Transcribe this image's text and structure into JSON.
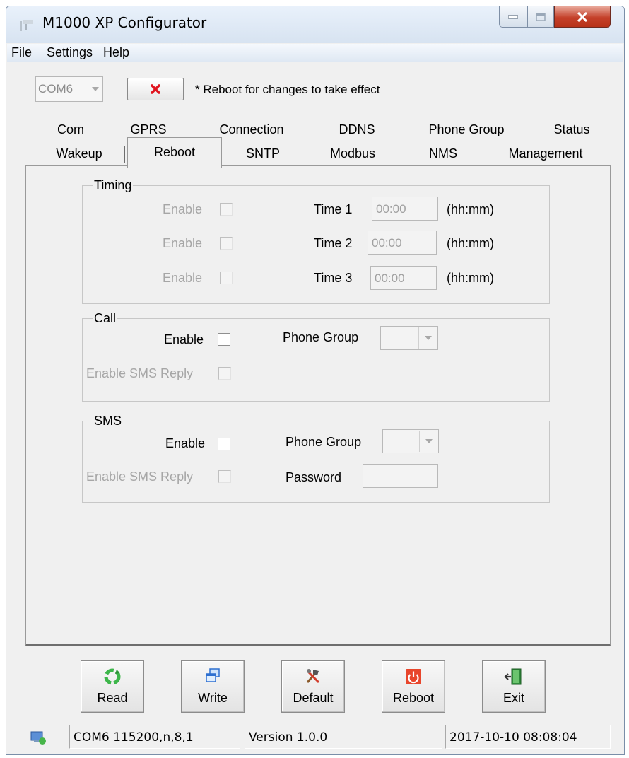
{
  "window": {
    "title": "M1000 XP Configurator"
  },
  "menu": {
    "file": "File",
    "settings": "Settings",
    "help": "Help"
  },
  "toolbar": {
    "com_port": "COM6",
    "reboot_note": "* Reboot for changes to take effect"
  },
  "tabs": {
    "row1": [
      "Com",
      "GPRS",
      "Connection",
      "DDNS",
      "Phone Group",
      "Status"
    ],
    "row2": [
      "Wakeup",
      "Reboot",
      "SNTP",
      "Modbus",
      "NMS",
      "Management"
    ],
    "selected": "Reboot"
  },
  "timing": {
    "legend": "Timing",
    "rows": [
      {
        "enable": "Enable",
        "time_label": "Time 1",
        "value": "00:00",
        "unit": "(hh:mm)"
      },
      {
        "enable": "Enable",
        "time_label": "Time 2",
        "value": "00:00",
        "unit": "(hh:mm)"
      },
      {
        "enable": "Enable",
        "time_label": "Time 3",
        "value": "00:00",
        "unit": "(hh:mm)"
      }
    ]
  },
  "call": {
    "legend": "Call",
    "enable": "Enable",
    "phone_group": "Phone Group",
    "sms_reply": "Enable SMS Reply"
  },
  "sms": {
    "legend": "SMS",
    "enable": "Enable",
    "phone_group": "Phone Group",
    "sms_reply": "Enable SMS Reply",
    "password": "Password"
  },
  "buttons": {
    "read": "Read",
    "write": "Write",
    "default": "Default",
    "reboot": "Reboot",
    "exit": "Exit"
  },
  "status": {
    "port": "COM6 115200,n,8,1",
    "version": "Version 1.0.0",
    "datetime": "2017-10-10 08:08:04"
  },
  "colors": {
    "close_red": "#c4402a",
    "reboot_icon": "#e8462c",
    "read_icon": "#3db64a"
  }
}
